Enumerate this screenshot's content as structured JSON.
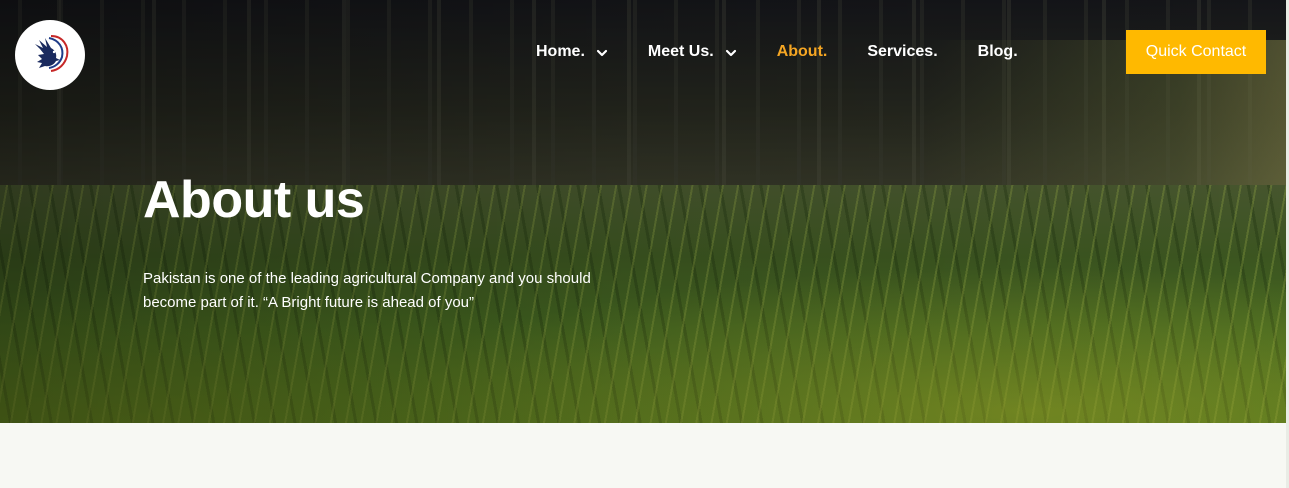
{
  "header": {
    "logo_icon": "eagle-icon",
    "nav": [
      {
        "label": "Home.",
        "has_dropdown": true,
        "active": false
      },
      {
        "label": "Meet Us.",
        "has_dropdown": true,
        "active": false
      },
      {
        "label": "About.",
        "has_dropdown": false,
        "active": true
      },
      {
        "label": "Services.",
        "has_dropdown": false,
        "active": false
      },
      {
        "label": "Blog.",
        "has_dropdown": false,
        "active": false
      }
    ],
    "cta_label": "Quick Contact"
  },
  "hero": {
    "title": "About us",
    "description": "Pakistan is one of the leading agricultural Company and you should become part of it. “A Bright future is ahead of you”"
  },
  "colors": {
    "accent": "#ffb900",
    "active_nav": "#f5a623",
    "page_background": "#f7f8f3"
  }
}
